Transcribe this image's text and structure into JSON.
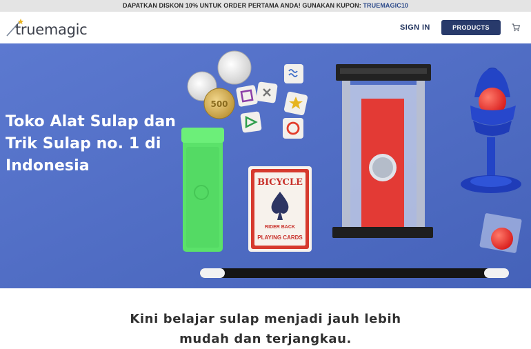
{
  "promo": {
    "text": "DAPATKAN DISKON 10% UNTUK ORDER PERTAMA ANDA! GUNAKAN KUPON:",
    "code": "TRUEMAGIC10"
  },
  "header": {
    "logo_text": "truemagic",
    "signin_label": "SIGN IN",
    "products_label": "PRODUCTS",
    "cart_icon": "cart-icon"
  },
  "hero": {
    "title": "Toko Alat Sulap dan Trik Sulap no. 1 di Indonesia",
    "card_brand": "BICYCLE",
    "card_subtitle": "RIDER BACK",
    "card_caption": "PLAYING CARDS",
    "coin_value": "500"
  },
  "tagline": {
    "line1": "Kini belajar sulap menjadi jauh lebih",
    "line2": "mudah dan terjangkau."
  },
  "colors": {
    "brand_navy": "#283a6b",
    "hero_blue": "#5470c8",
    "promo_bg": "#e4e4e4"
  }
}
